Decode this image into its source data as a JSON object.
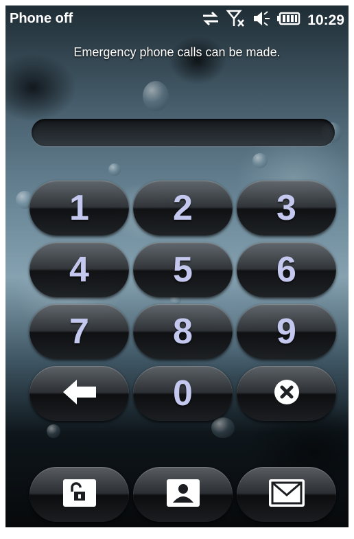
{
  "status_bar": {
    "carrier": "Phone off",
    "time": "10:29",
    "icons": [
      "data-sync-icon",
      "no-signal-icon",
      "speaker-icon",
      "battery-icon"
    ]
  },
  "message": "Emergency phone calls can be made.",
  "pin_field": {
    "value": ""
  },
  "keypad": {
    "keys": [
      "1",
      "2",
      "3",
      "4",
      "5",
      "6",
      "7",
      "8",
      "9",
      "0"
    ],
    "back_icon": "back-arrow-icon",
    "clear_icon": "clear-x-icon"
  },
  "bottom_bar": {
    "icons": [
      "unlock-icon",
      "contact-icon",
      "message-icon"
    ]
  },
  "colors": {
    "digit": "#c5c8ee",
    "text": "#ffffff"
  }
}
